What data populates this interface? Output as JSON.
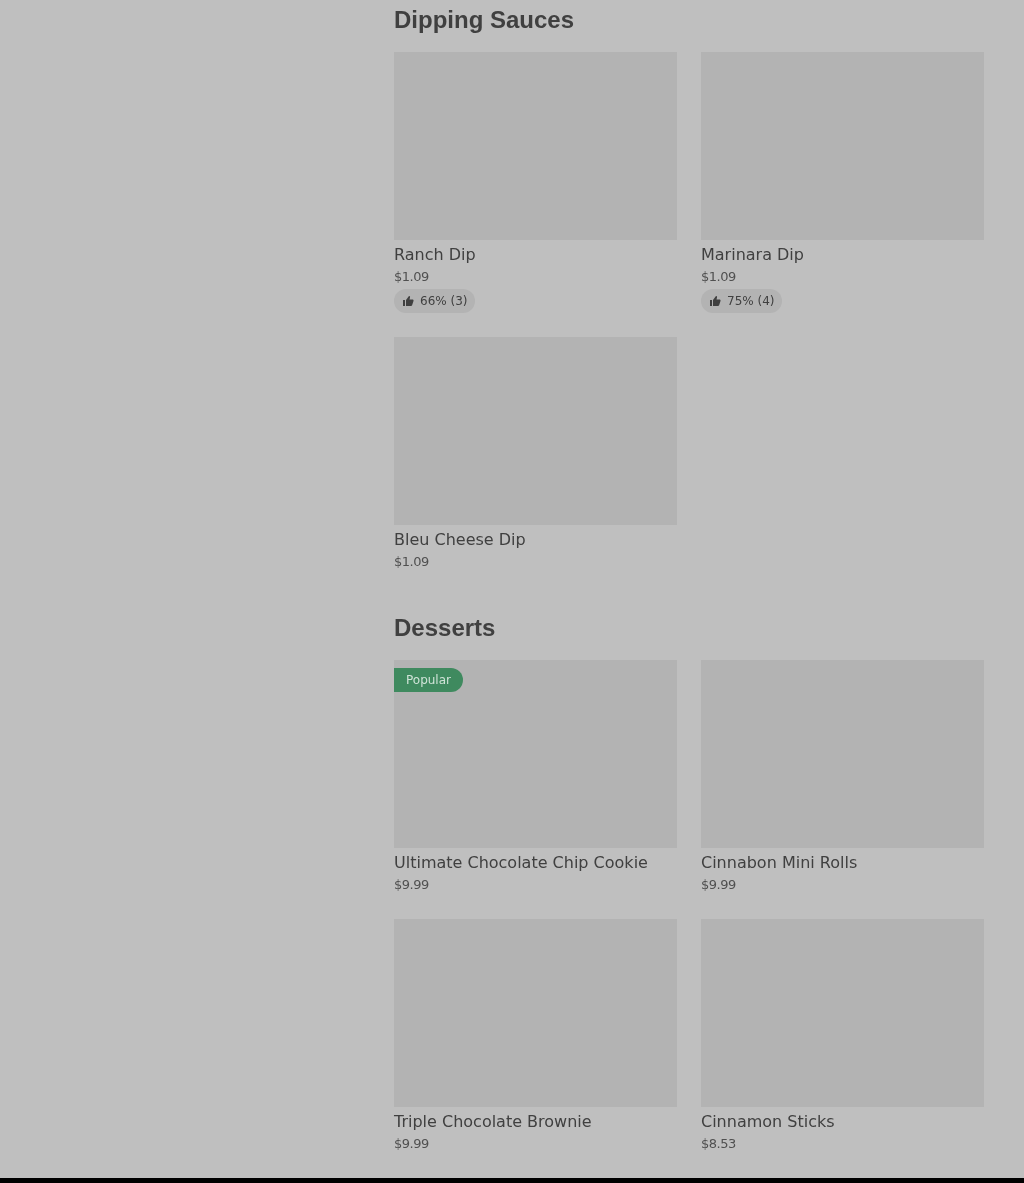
{
  "sections": [
    {
      "title": "Dipping Sauces",
      "items": [
        {
          "name": "Ranch Dip",
          "price": "$1.09",
          "rating": "66% (3)"
        },
        {
          "name": "Marinara Dip",
          "price": "$1.09",
          "rating": "75% (4)"
        },
        {
          "name": "Bleu Cheese Dip",
          "price": "$1.09"
        }
      ]
    },
    {
      "title": "Desserts",
      "items": [
        {
          "name": "Ultimate Chocolate Chip Cookie",
          "price": "$9.99",
          "badge": "Popular"
        },
        {
          "name": "Cinnabon Mini Rolls",
          "price": "$9.99"
        },
        {
          "name": "Triple Chocolate Brownie",
          "price": "$9.99"
        },
        {
          "name": "Cinnamon Sticks",
          "price": "$8.53"
        }
      ]
    }
  ]
}
